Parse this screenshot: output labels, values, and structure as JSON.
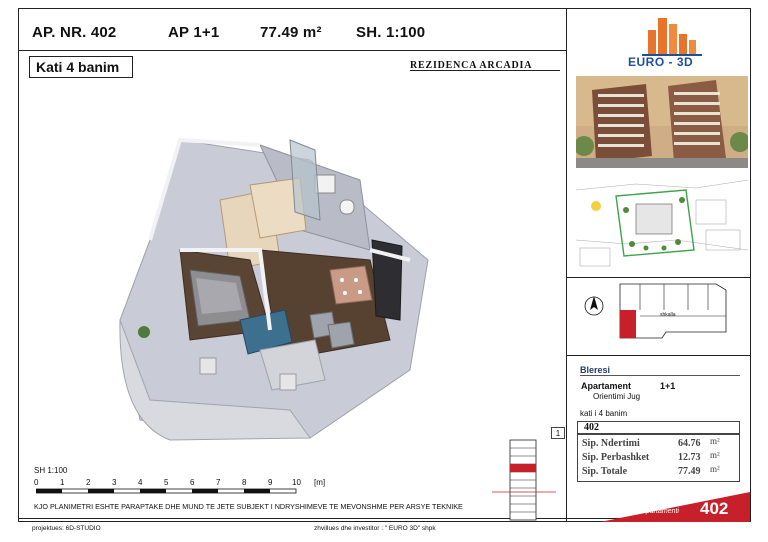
{
  "header": {
    "apartment_number": "AP. NR. 402",
    "type": "AP 1+1",
    "area": "77.49 m²",
    "scale": "SH. 1:100"
  },
  "floor_label": "Kati 4 banim",
  "residence_name": "REZIDENCA ARCADIA",
  "scale_bar": {
    "title": "SH 1:100",
    "ticks": [
      "0",
      "1",
      "2",
      "3",
      "4",
      "5",
      "6",
      "7",
      "8",
      "9",
      "10",
      "[m]"
    ]
  },
  "disclaimer": "KJO PLANIMETRI ESHTE PARAPTAKE DHE MUND TE JETE SUBJEKT I NDRYSHIMEVE TE MEVONSHME PER ARSYE TEKNIKE",
  "footer": {
    "project": "projektues:  6D-STUDIO",
    "developer": "zhvillues dhe investitor :  \" EURO 3D\" shpk"
  },
  "logo_text": "EURO - 3D",
  "keyplan_label": "shkalla",
  "info": {
    "buyer_label": "Bleresi",
    "apartment_label": "Apartament",
    "apartment_type": "1+1",
    "orientation": "Orientimi  Jug",
    "floor": "kati i 4 banim",
    "number": "402",
    "index": "1",
    "areas": [
      {
        "label": "Sip. Ndertimi",
        "value": "64.76",
        "unit": "m²"
      },
      {
        "label": "Sip. Perbashket",
        "value": "12.73",
        "unit": "m²"
      },
      {
        "label": "Sip. Totale",
        "value": "77.49",
        "unit": "m²"
      }
    ]
  },
  "badge": {
    "label": "apartamenti",
    "number": "402"
  },
  "colors": {
    "brand_red": "#c8202a",
    "logo_orange": "#e8732a",
    "logo_blue": "#1f4e9c",
    "buyer_blue": "#1f3e6b"
  }
}
